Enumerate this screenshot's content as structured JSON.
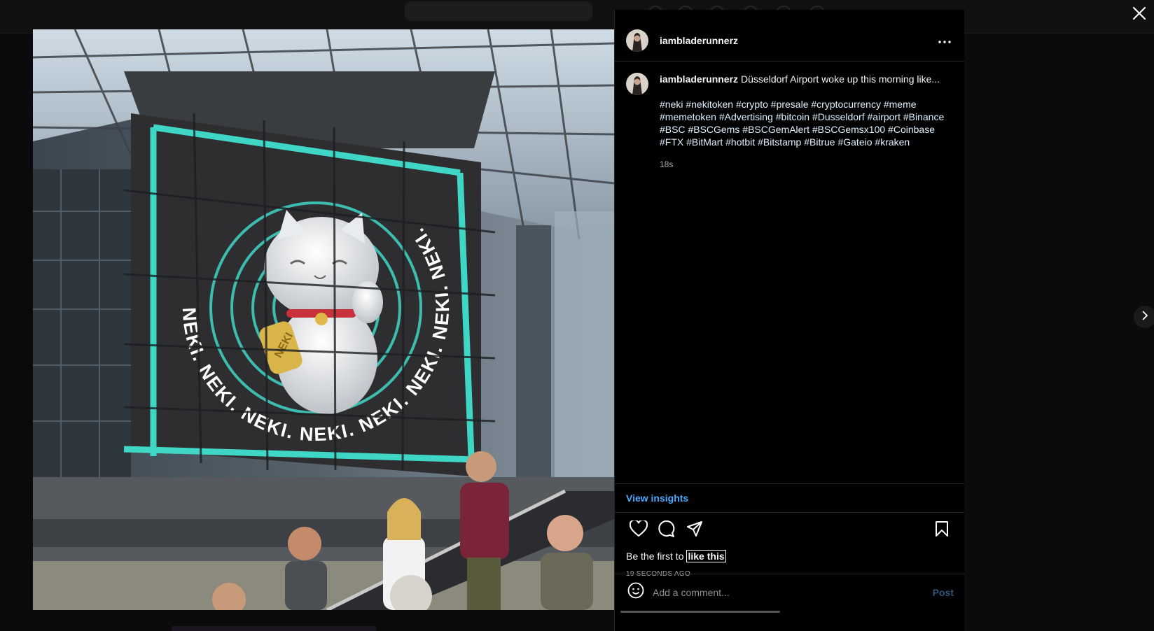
{
  "post": {
    "username": "iambladerunnerz",
    "caption_text": "Düsseldorf Airport woke up this morning like...",
    "hashtags": [
      "#neki",
      "#nekitoken",
      "#crypto",
      "#presale",
      "#cryptocurrency",
      "#meme",
      "#memetoken",
      "#Advertising",
      "#bitcoin",
      "#Dusseldorf",
      "#airport",
      "#Binance",
      "#BSC",
      "#BSCGems",
      "#BSCGemAlert",
      "#BSCGemsx100",
      "#Coinbase",
      "#FTX",
      "#BitMart",
      "#hotbit",
      "#Bitstamp",
      "#Bitrue",
      "#Gateio",
      "#kraken"
    ],
    "caption_age": "18s",
    "insights_label": "View insights",
    "likes_prefix": "Be the first to",
    "likes_link": "like this",
    "posted_ago": "19 SECONDS AGO"
  },
  "comment": {
    "placeholder": "Add a comment...",
    "post_label": "Post"
  },
  "media": {
    "sign_text": "NEKI. NEKI. NEKI. NEKI. NEKI. NEKI. NEKI. NEKI. ",
    "coin_text": "NEKI",
    "accent_color": "#3fd6c6"
  },
  "icons": {
    "close": "close-icon",
    "next": "chevron-right-icon",
    "more": "more-horizontal-icon",
    "like": "heart-icon",
    "comment": "comment-icon",
    "share": "paper-plane-icon",
    "save": "bookmark-icon",
    "emoji": "emoji-icon"
  }
}
